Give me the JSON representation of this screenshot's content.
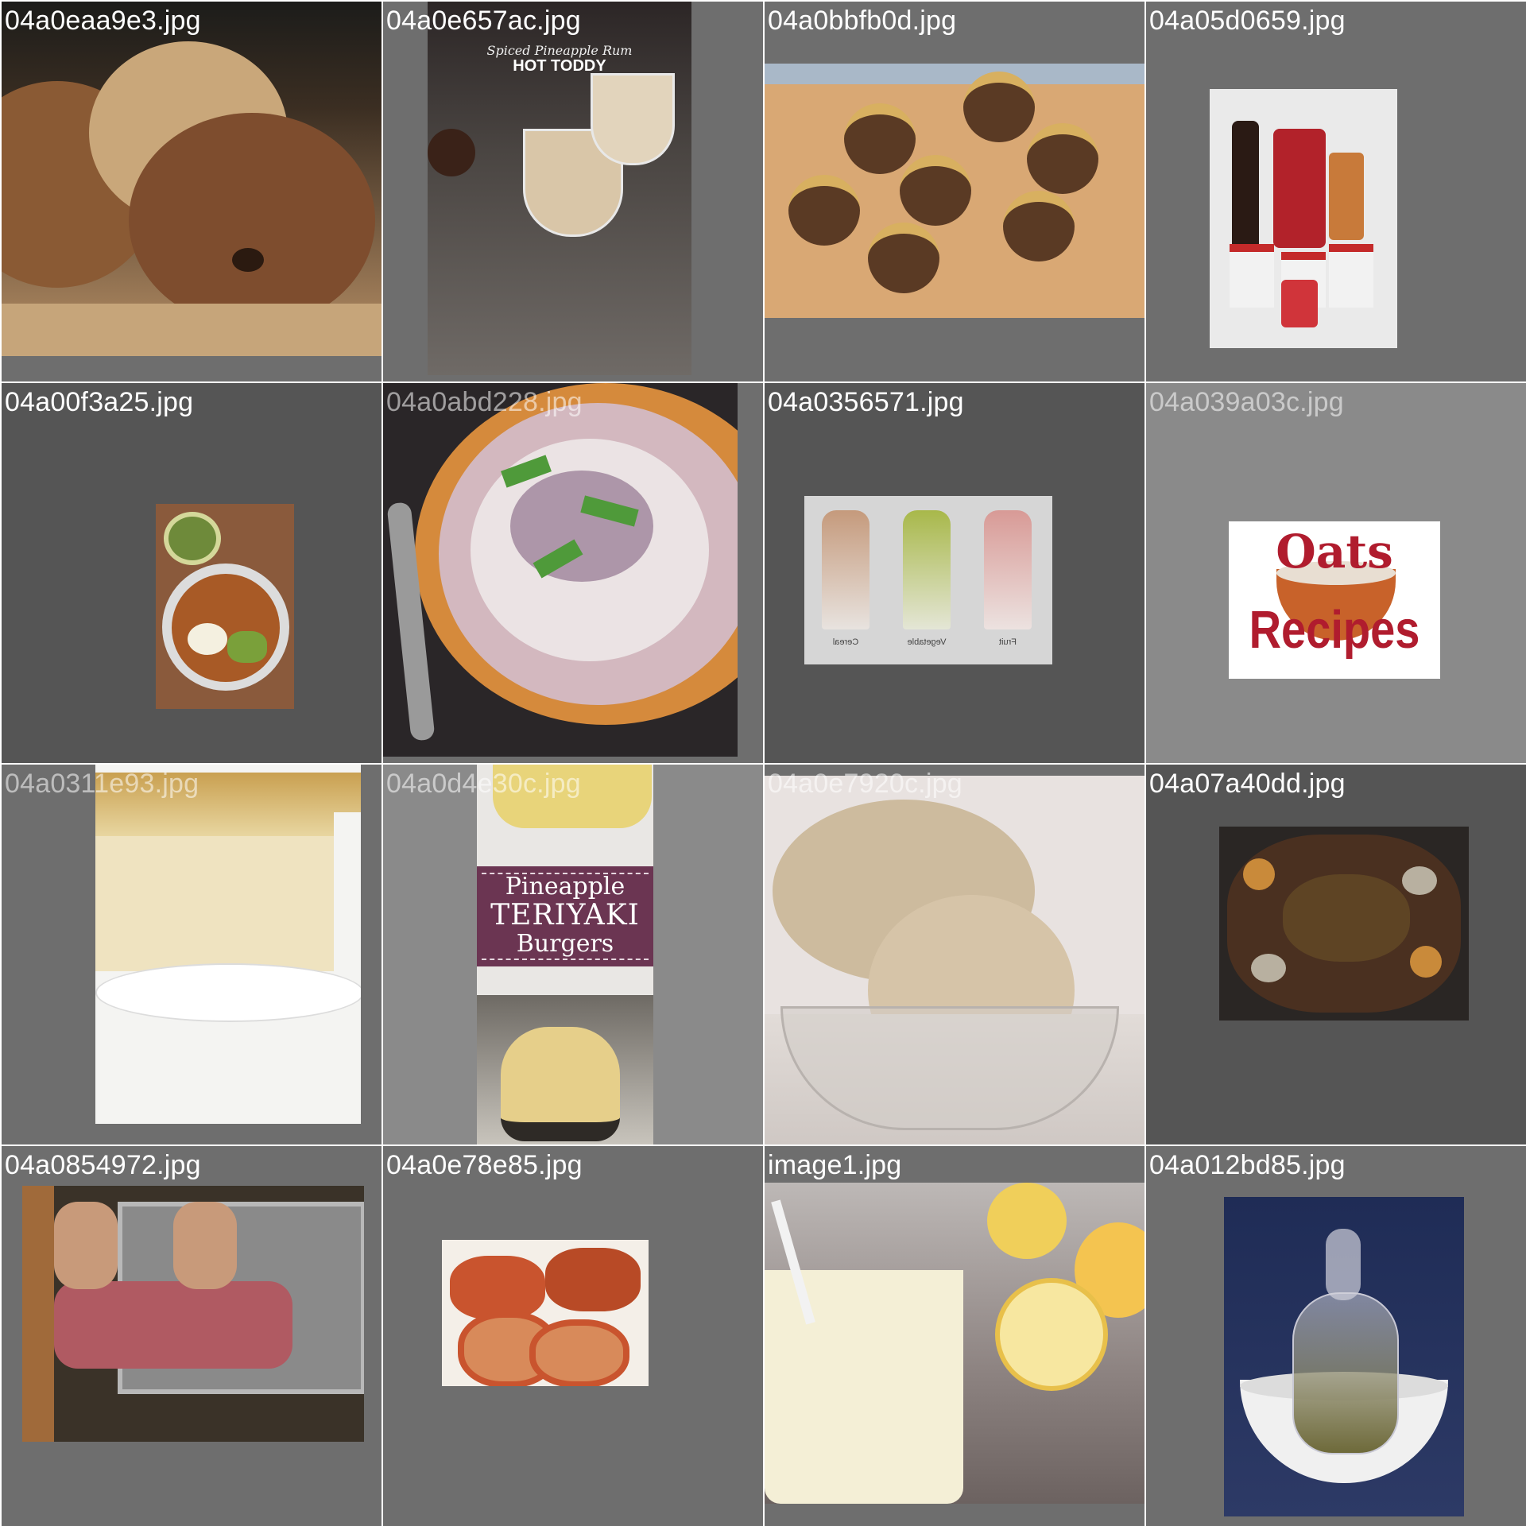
{
  "grid": {
    "tiles": [
      {
        "filename": "04a0eaa9e3.jpg"
      },
      {
        "filename": "04a0e657ac.jpg",
        "overlay": {
          "line1": "Spiced Pineapple Rum",
          "line2": "HOT TODDY"
        }
      },
      {
        "filename": "04a0bbfb0d.jpg"
      },
      {
        "filename": "04a05d0659.jpg"
      },
      {
        "filename": "04a00f3a25.jpg"
      },
      {
        "filename": "04a0abd228.jpg"
      },
      {
        "filename": "04a0356571.jpg",
        "labels": [
          "Cereal",
          "Vegetable",
          "Fruit"
        ]
      },
      {
        "filename": "04a039a03c.jpg",
        "overlay": {
          "line1": "Oats",
          "line2": "Recipes"
        }
      },
      {
        "filename": "04a0311e93.jpg"
      },
      {
        "filename": "04a0d4e30c.jpg",
        "overlay": {
          "line1": "Pineapple",
          "line2": "TERIYAKI",
          "line3": "Burgers"
        }
      },
      {
        "filename": "04a0e7920c.jpg"
      },
      {
        "filename": "04a07a40dd.jpg"
      },
      {
        "filename": "04a0854972.jpg"
      },
      {
        "filename": "04a0e78e85.jpg"
      },
      {
        "filename": "image1.jpg"
      },
      {
        "filename": "04a012bd85.jpg"
      }
    ]
  },
  "colors": {
    "tile_bg_mid": "#6e6e6e",
    "tile_bg_dark": "#555555",
    "tile_bg_light": "#8a8a8a",
    "oats_red": "#b01c2e",
    "burger_banner": "#6b3552"
  }
}
